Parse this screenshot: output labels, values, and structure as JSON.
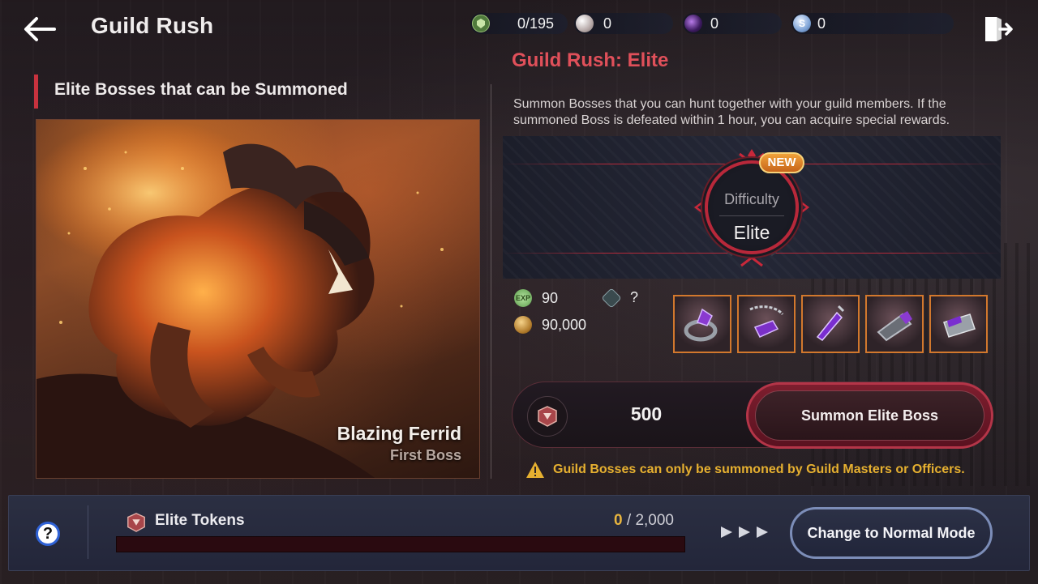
{
  "header": {
    "title": "Guild Rush",
    "currencies": [
      {
        "icon": "guild-crest-icon",
        "value": "0/195",
        "color": "#6c9a52"
      },
      {
        "icon": "pearl-icon",
        "value": "0",
        "color": "#d8d0cf"
      },
      {
        "icon": "dark-orb-icon",
        "value": "0",
        "color": "#5a2e8a"
      },
      {
        "icon": "silver-coin-icon",
        "value": "0",
        "color": "#8fb0d8"
      }
    ]
  },
  "left": {
    "heading": "Elite Bosses that can be Summoned",
    "boss_name": "Blazing Ferrid",
    "boss_sub": "First Boss"
  },
  "right": {
    "title": "Guild Rush: Elite",
    "description": "Summon Bosses that you can hunt together with your guild members. If the summoned Boss is defeated within 1 hour, you can acquire special rewards.",
    "difficulty": {
      "label": "Difficulty",
      "value": "Elite",
      "new_badge": "NEW"
    },
    "rewards": {
      "exp": "90",
      "gold": "90,000",
      "unknown": "?"
    },
    "items": [
      {
        "icon": "amethyst-ring-icon"
      },
      {
        "icon": "chain-necklace-icon"
      },
      {
        "icon": "gem-pendant-icon"
      },
      {
        "icon": "bracer-icon"
      },
      {
        "icon": "engraved-ring-icon"
      }
    ],
    "summon": {
      "cost": "500",
      "button": "Summon Elite Boss"
    },
    "warning": "Guild Bosses can only be summoned by Guild Masters or Officers."
  },
  "bottom": {
    "help": "?",
    "tokens_label": "Elite Tokens",
    "tokens_current": "0",
    "tokens_max": "/ 2,000",
    "progress": 0,
    "arrows": "▶▶▶",
    "mode_button": "Change to Normal Mode"
  },
  "colors": {
    "accent_red": "#c8323e",
    "warning": "#e6b030",
    "item_border": "#d2782d"
  }
}
